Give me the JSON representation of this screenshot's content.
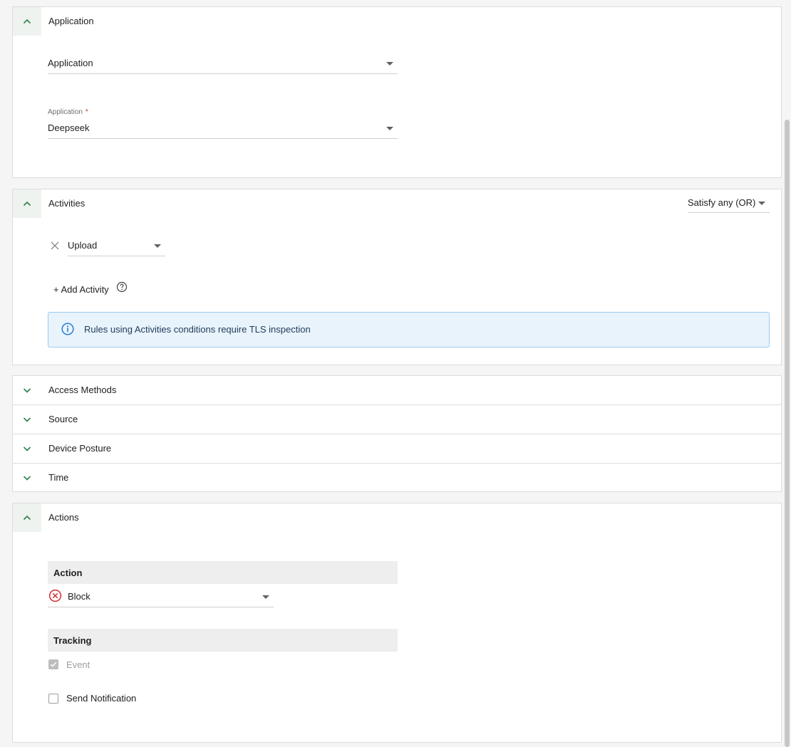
{
  "application_panel": {
    "title": "Application",
    "type_select": {
      "value": "Application"
    },
    "app_select": {
      "label": "Application",
      "required_mark": "*",
      "value": "Deepseek"
    }
  },
  "activities_panel": {
    "title": "Activities",
    "match_select": {
      "value": "Satisfy any (OR)"
    },
    "activity_select": {
      "value": "Upload"
    },
    "add_activity_label": "+ Add Activity",
    "info_text": "Rules using Activities conditions require TLS inspection"
  },
  "collapsed_sections": [
    {
      "title": "Access Methods"
    },
    {
      "title": "Source"
    },
    {
      "title": "Device Posture"
    },
    {
      "title": "Time"
    }
  ],
  "actions_panel": {
    "title": "Actions",
    "action_header": "Action",
    "action_select": {
      "value": "Block"
    },
    "tracking_header": "Tracking",
    "event_label": "Event",
    "event_checked": true,
    "notification_label": "Send Notification",
    "notification_checked": false
  },
  "icons": {
    "expand": "chevron-up-icon",
    "collapse": "chevron-down-icon",
    "remove": "close-icon",
    "help": "help-circle-icon",
    "info": "info-circle-icon",
    "block": "block-circle-icon"
  },
  "colors": {
    "accent_green": "#2e7d4f",
    "info_blue": "#1976d2",
    "block_red": "#d32f2f"
  }
}
